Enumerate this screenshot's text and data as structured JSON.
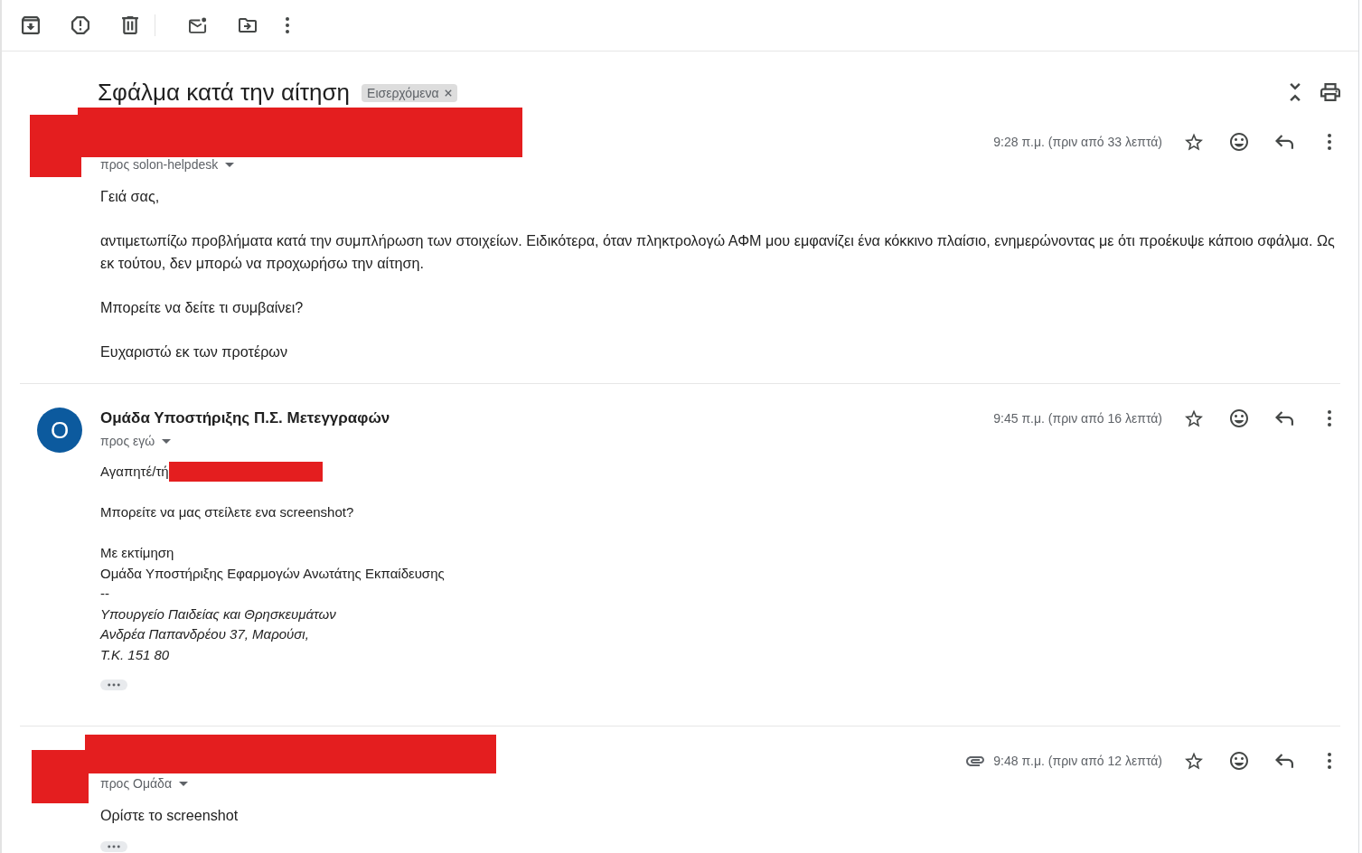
{
  "thread": {
    "subject": "Σφάλμα κατά την αίτηση",
    "labels": [
      {
        "text": "Εισερχόμενα"
      }
    ]
  },
  "messages": [
    {
      "kind": "plain",
      "redacted": true,
      "recipient": "προς solon-helpdesk",
      "has_attachment": false,
      "time": "9:28 π.μ. (πριν από 33 λεπτά)",
      "starred": false,
      "paragraphs": [
        {
          "lines": [
            {
              "text": "Γειά σας,",
              "italic": false,
              "redacted": false
            }
          ]
        },
        {
          "lines": [
            {
              "text": "αντιμετωπίζω προβλήματα κατά την συμπλήρωση των στοιχείων. Ειδικότερα, όταν πληκτρολογώ ΑΦΜ μου εμφανίζει ένα κόκκινο πλαίσιο, ενημερώνοντας με ότι προέκυψε κάποιο σφάλμα. Ως εκ τούτου, δεν μπορώ να προχωρήσω την αίτηση.",
              "italic": false,
              "redacted": false
            }
          ]
        },
        {
          "lines": [
            {
              "text": "Μπορείτε να δείτε τι συμβαίνει?",
              "italic": false,
              "redacted": false
            }
          ]
        },
        {
          "lines": [
            {
              "text": "Ευχαριστώ εκ των προτέρων",
              "italic": false,
              "redacted": false
            }
          ]
        }
      ],
      "trimmed_content": false
    },
    {
      "kind": "formatted",
      "redacted": false,
      "avatar_letter": "Ο",
      "sender": "Ομάδα Υποστήριξης Π.Σ. Μετεγγραφών",
      "recipient": "προς εγώ",
      "has_attachment": false,
      "time": "9:45 π.μ. (πριν από 16 λεπτά)",
      "starred": false,
      "paragraphs": [
        {
          "lines": [
            {
              "text": "Αγαπητέ/τή",
              "italic": false,
              "redacted": true
            }
          ]
        },
        {
          "lines": [
            {
              "text": "Μπορείτε να μας στείλετε ενα screenshot?",
              "italic": false,
              "redacted": false
            }
          ]
        },
        {
          "lines": [
            {
              "text": "Με εκτίμηση",
              "italic": false,
              "redacted": false
            },
            {
              "text": "Ομάδα Υποστήριξης Εφαρμογών Ανωτάτης Εκπαίδευσης",
              "italic": false,
              "redacted": false
            },
            {
              "text": "--",
              "italic": false,
              "redacted": false
            },
            {
              "text": "Υπουργείο Παιδείας και Θρησκευμάτων",
              "italic": true,
              "redacted": false
            },
            {
              "text": "Ανδρέα Παπανδρέου 37, Μαρούσι,",
              "italic": true,
              "redacted": false
            },
            {
              "text": "Τ.Κ. 151 80",
              "italic": true,
              "redacted": false
            }
          ]
        }
      ],
      "trimmed_content": true
    },
    {
      "kind": "plain",
      "redacted": true,
      "recipient": "προς Ομάδα",
      "has_attachment": true,
      "time": "9:48 π.μ. (πριν από 12 λεπτά)",
      "starred": false,
      "paragraphs": [
        {
          "lines": [
            {
              "text": "Ορίστε το screenshot",
              "italic": false,
              "redacted": false
            }
          ]
        }
      ],
      "trimmed_content": true
    }
  ]
}
